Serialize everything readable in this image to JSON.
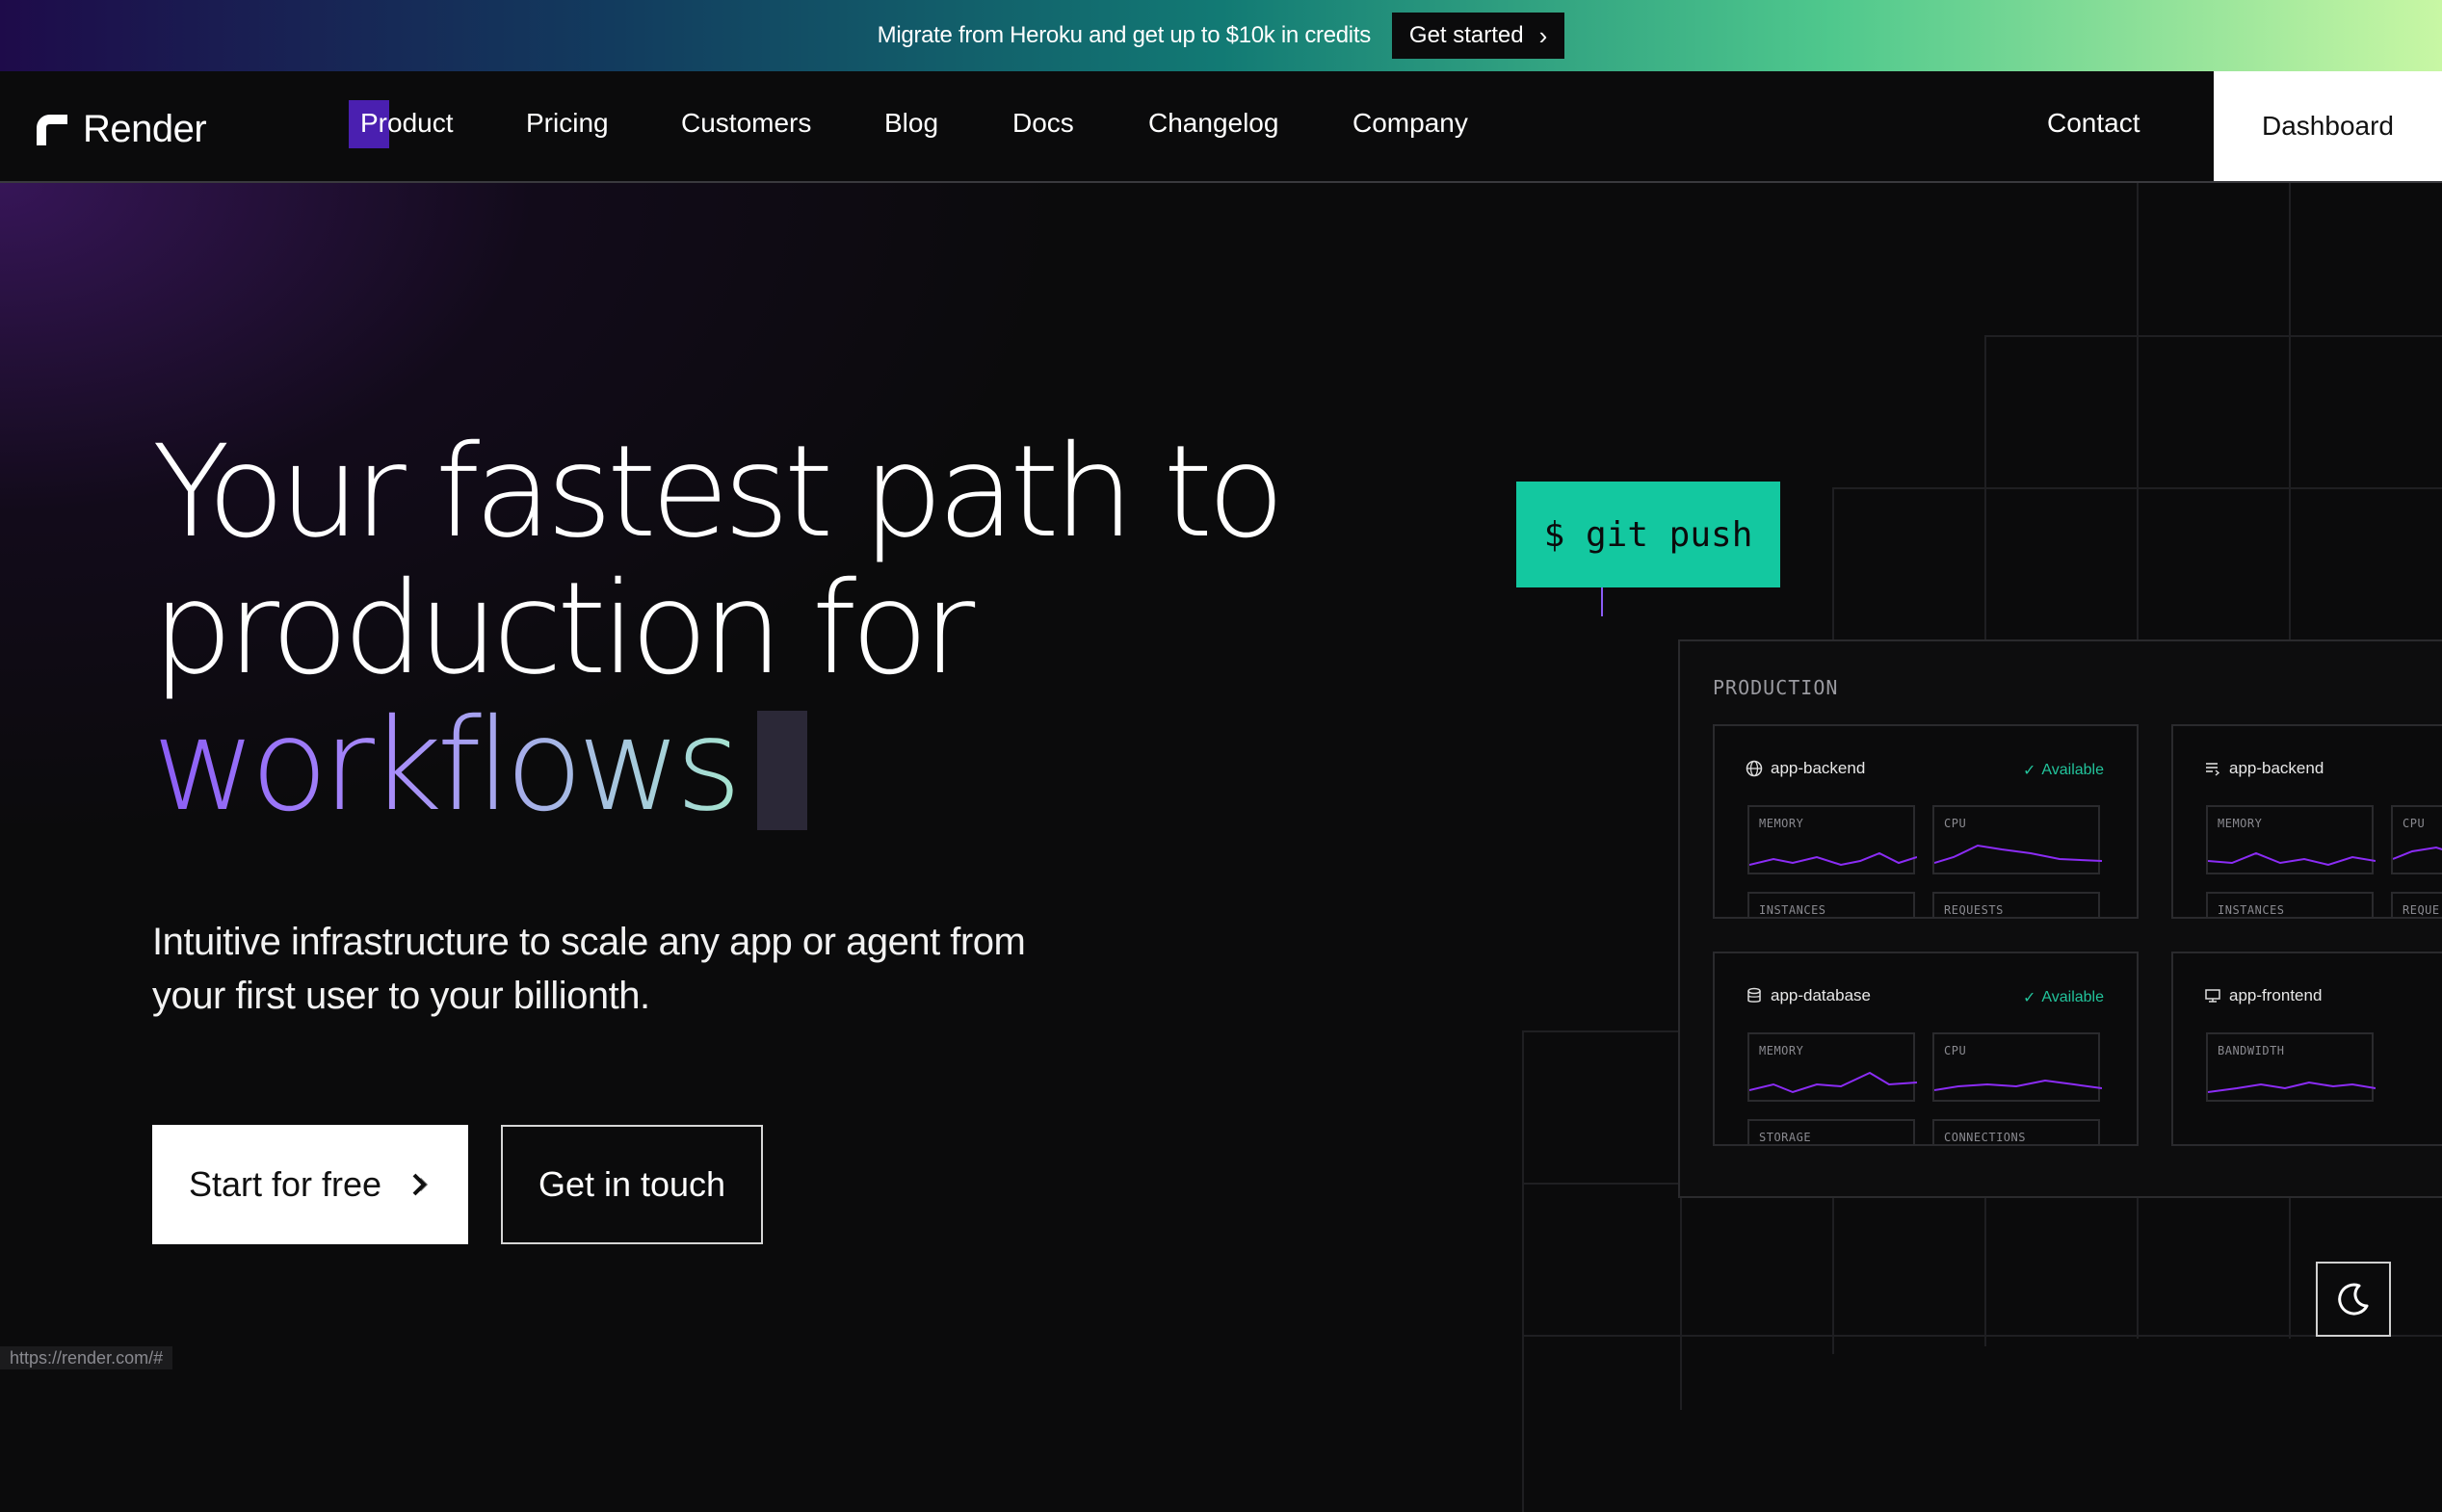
{
  "banner": {
    "text": "Migrate from Heroku and get up to $10k in credits",
    "button": "Get started"
  },
  "nav": {
    "logo": "Render",
    "items": [
      "Product",
      "Pricing",
      "Customers",
      "Blog",
      "Docs",
      "Changelog",
      "Company"
    ],
    "contact": "Contact",
    "dashboard": "Dashboard"
  },
  "hero": {
    "line1": "Your fastest path to",
    "line2": "production for",
    "line3": "workflows",
    "subtitle_line1": "Intuitive infrastructure to scale any app or agent from",
    "subtitle_line2": "your first user to your billionth.",
    "primary_button": "Start for free",
    "secondary_button": "Get in touch"
  },
  "terminal": {
    "command": "$ git push"
  },
  "production": {
    "title": "PRODUCTION",
    "cards": [
      {
        "name": "app-backend",
        "icon": "globe-icon",
        "status": "Available",
        "metrics": [
          "MEMORY",
          "CPU"
        ],
        "footer": [
          "INSTANCES",
          "REQUESTS"
        ]
      },
      {
        "name": "app-backend",
        "icon": "list-icon",
        "status": "",
        "metrics": [
          "MEMORY",
          "CPU"
        ],
        "footer": [
          "INSTANCES",
          "REQUE"
        ]
      },
      {
        "name": "app-database",
        "icon": "database-icon",
        "status": "Available",
        "metrics": [
          "MEMORY",
          "CPU"
        ],
        "footer": [
          "STORAGE",
          "CONNECTIONS"
        ]
      },
      {
        "name": "app-frontend",
        "icon": "monitor-icon",
        "status": "",
        "metrics": [
          "BANDWIDTH"
        ],
        "footer": []
      }
    ]
  },
  "statusbar": "https://render.com/#",
  "colors": {
    "accent_green": "#13c8a0",
    "accent_purple": "#8b5cf6",
    "available": "#22c39b"
  }
}
